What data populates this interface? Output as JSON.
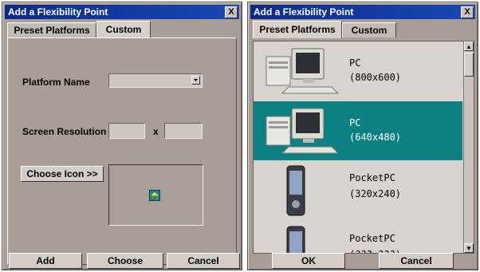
{
  "left_dialog": {
    "title": "Add a Flexibility Point",
    "close_label": "X",
    "tabs": [
      "Preset Platforms",
      "Custom"
    ],
    "platform_name_label": "Platform Name",
    "platform_name_value": "",
    "screen_resolution_label": "Screen Resolution",
    "res_width_value": "",
    "res_height_value": "",
    "res_separator": "x",
    "choose_icon_label": "Choose Icon >>",
    "buttons": {
      "add": "Add",
      "choose": "Choose",
      "cancel": "Cancel"
    }
  },
  "right_dialog": {
    "title": "Add a Flexibility Point",
    "close_label": "X",
    "tabs": [
      "Preset Platforms",
      "Custom"
    ],
    "platforms": [
      {
        "name": "PC",
        "resolution": "(800x600)",
        "icon": "desktop-pc-icon",
        "selected": false
      },
      {
        "name": "PC",
        "resolution": "(640x480)",
        "icon": "desktop-pc-icon",
        "selected": true
      },
      {
        "name": "PocketPC",
        "resolution": "(320x240)",
        "icon": "pocketpc-icon",
        "selected": false
      },
      {
        "name": "PocketPC",
        "resolution": "(??? ???)",
        "icon": "pocketpc-icon",
        "selected": false
      }
    ],
    "buttons": {
      "ok": "OK",
      "cancel": "Cancel"
    }
  },
  "colors": {
    "titlebar": "#0a2a8a",
    "dialog_bg": "#a99d97",
    "selection": "#0c8183"
  }
}
